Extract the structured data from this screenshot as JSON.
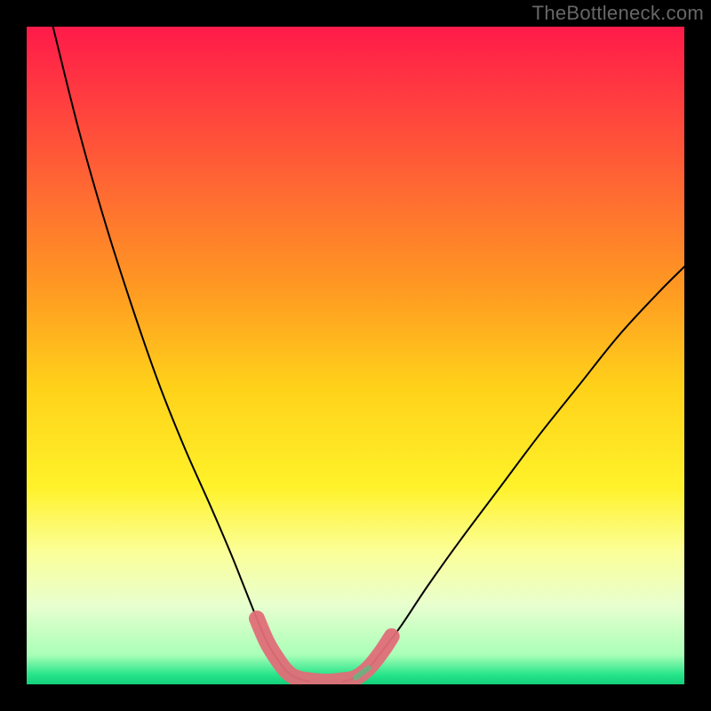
{
  "watermark": "TheBottleneck.com",
  "chart_data": {
    "type": "line",
    "title": "",
    "xlabel": "",
    "ylabel": "",
    "x_range": [
      0,
      100
    ],
    "y_range": [
      0,
      100
    ],
    "gradient_stops": [
      {
        "offset": 0.0,
        "color": "#ff1a4a"
      },
      {
        "offset": 0.2,
        "color": "#ff5a37"
      },
      {
        "offset": 0.4,
        "color": "#ff9a22"
      },
      {
        "offset": 0.55,
        "color": "#ffd21a"
      },
      {
        "offset": 0.7,
        "color": "#fff22a"
      },
      {
        "offset": 0.8,
        "color": "#fbff9a"
      },
      {
        "offset": 0.88,
        "color": "#e8ffcf"
      },
      {
        "offset": 0.955,
        "color": "#aaffb8"
      },
      {
        "offset": 0.985,
        "color": "#28e58b"
      },
      {
        "offset": 1.0,
        "color": "#13cf7a"
      }
    ],
    "series": [
      {
        "name": "left-curve",
        "color": "#000000",
        "points": [
          {
            "x": 4.0,
            "y": 100.0
          },
          {
            "x": 8.0,
            "y": 84.0
          },
          {
            "x": 12.0,
            "y": 70.0
          },
          {
            "x": 16.0,
            "y": 57.5
          },
          {
            "x": 20.0,
            "y": 46.0
          },
          {
            "x": 24.0,
            "y": 36.0
          },
          {
            "x": 28.0,
            "y": 27.0
          },
          {
            "x": 31.0,
            "y": 20.0
          },
          {
            "x": 33.0,
            "y": 15.0
          },
          {
            "x": 35.0,
            "y": 10.0
          },
          {
            "x": 36.5,
            "y": 6.5
          },
          {
            "x": 38.0,
            "y": 4.0
          },
          {
            "x": 39.5,
            "y": 2.0
          },
          {
            "x": 41.0,
            "y": 1.0
          },
          {
            "x": 43.0,
            "y": 0.4
          }
        ]
      },
      {
        "name": "right-curve",
        "color": "#000000",
        "points": [
          {
            "x": 48.0,
            "y": 0.4
          },
          {
            "x": 50.0,
            "y": 1.0
          },
          {
            "x": 52.0,
            "y": 2.5
          },
          {
            "x": 54.0,
            "y": 5.0
          },
          {
            "x": 57.0,
            "y": 9.0
          },
          {
            "x": 61.0,
            "y": 15.0
          },
          {
            "x": 66.0,
            "y": 22.0
          },
          {
            "x": 72.0,
            "y": 30.0
          },
          {
            "x": 78.0,
            "y": 38.0
          },
          {
            "x": 84.0,
            "y": 45.5
          },
          {
            "x": 90.0,
            "y": 53.0
          },
          {
            "x": 96.0,
            "y": 59.5
          },
          {
            "x": 100.0,
            "y": 63.5
          }
        ]
      },
      {
        "name": "highlight-band",
        "color": "#e06e78",
        "stroke_width": 18,
        "points": [
          {
            "x": 35.0,
            "y": 10.0
          },
          {
            "x": 36.5,
            "y": 6.5
          },
          {
            "x": 38.0,
            "y": 4.0
          },
          {
            "x": 39.5,
            "y": 2.0
          },
          {
            "x": 41.0,
            "y": 1.0
          },
          {
            "x": 43.0,
            "y": 0.6
          },
          {
            "x": 45.5,
            "y": 0.4
          },
          {
            "x": 48.0,
            "y": 0.6
          },
          {
            "x": 50.0,
            "y": 1.0
          },
          {
            "x": 52.0,
            "y": 2.5
          },
          {
            "x": 54.0,
            "y": 5.0
          },
          {
            "x": 55.5,
            "y": 7.3
          }
        ]
      }
    ]
  }
}
